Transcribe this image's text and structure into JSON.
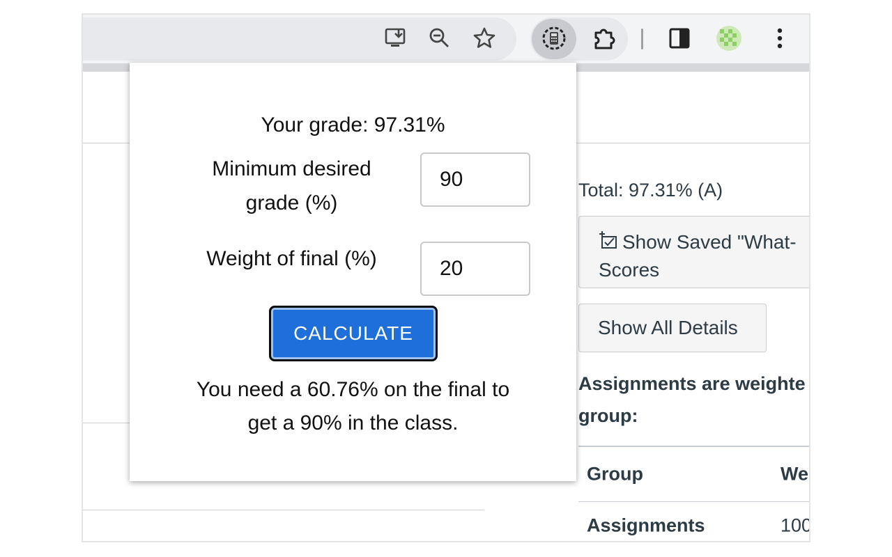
{
  "toolbar": {
    "icons": [
      "install-icon",
      "zoom-out-icon",
      "bookmark-star-icon",
      "calculator-extension-icon",
      "puzzle-extensions-icon",
      "side-panel-icon",
      "profile-avatar-icon",
      "more-menu-icon"
    ]
  },
  "popup": {
    "grade_text": "Your grade: 97.31%",
    "min_grade_label_line1": "Minimum desired",
    "min_grade_label_line2": "grade (%)",
    "min_grade_value": "90",
    "weight_label": "Weight of final (%)",
    "weight_value": "20",
    "calculate_label": "CALCULATE",
    "result_line1": "You need a 60.76% on the final to",
    "result_line2": "get a 90% in the class.",
    "accent_color": "#1e6fd9"
  },
  "grades_panel": {
    "total": "Total: 97.31% (A)",
    "show_saved_line1": "Show Saved \"What-",
    "show_saved_line2": "Scores",
    "show_all_details": "Show All Details",
    "weighted_line1": "Assignments are weighte",
    "weighted_line2": "group:",
    "table": {
      "headers": [
        "Group",
        "We"
      ],
      "rows": [
        [
          "Assignments",
          "100"
        ]
      ]
    }
  }
}
